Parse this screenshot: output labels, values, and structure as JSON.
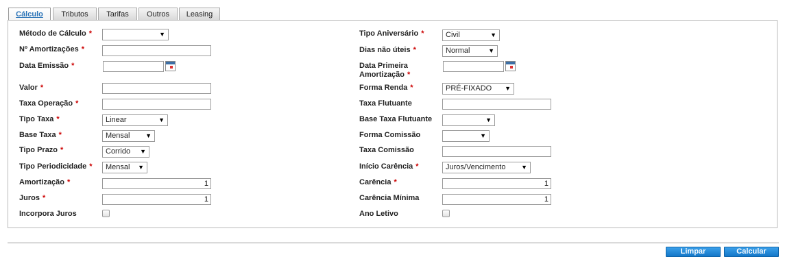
{
  "tabs": [
    "Cálculo",
    "Tributos",
    "Tarifas",
    "Outros",
    "Leasing"
  ],
  "required_mark": "*",
  "left": {
    "metodo_calculo": {
      "label": "Método de Cálculo",
      "value": ""
    },
    "num_amortizacoes": {
      "label": "Nº Amortizações",
      "value": ""
    },
    "data_emissao": {
      "label": "Data Emissão",
      "value": ""
    },
    "valor": {
      "label": "Valor",
      "value": ""
    },
    "taxa_operacao": {
      "label": "Taxa Operação",
      "value": ""
    },
    "tipo_taxa": {
      "label": "Tipo Taxa",
      "value": "Linear"
    },
    "base_taxa": {
      "label": "Base Taxa",
      "value": "Mensal"
    },
    "tipo_prazo": {
      "label": "Tipo Prazo",
      "value": "Corrido"
    },
    "tipo_periodicidade": {
      "label": "Tipo Periodicidade",
      "value": "Mensal"
    },
    "amortizacao": {
      "label": "Amortização",
      "value": "1"
    },
    "juros": {
      "label": "Juros",
      "value": "1"
    },
    "incorpora_juros": {
      "label": "Incorpora Juros",
      "checked": false
    }
  },
  "right": {
    "tipo_aniversario": {
      "label": "Tipo Aniversário",
      "value": "Civil"
    },
    "dias_nao_uteis": {
      "label": "Dias não úteis",
      "value": "Normal"
    },
    "data_primeira_amortizacao": {
      "label_line1": "Data Primeira",
      "label_line2": "Amortização",
      "value": ""
    },
    "forma_renda": {
      "label": "Forma Renda",
      "value": "PRÉ-FIXADO"
    },
    "taxa_flutuante": {
      "label": "Taxa Flutuante",
      "value": ""
    },
    "base_taxa_flutuante": {
      "label": "Base Taxa Flutuante",
      "value": ""
    },
    "forma_comissao": {
      "label": "Forma Comissão",
      "value": ""
    },
    "taxa_comissao": {
      "label": "Taxa Comissão",
      "value": ""
    },
    "inicio_carencia": {
      "label": "Início Carência",
      "value": "Juros/Vencimento"
    },
    "carencia": {
      "label": "Carência",
      "value": "1"
    },
    "carencia_minima": {
      "label": "Carência Mínima",
      "value": "1"
    },
    "ano_letivo": {
      "label": "Ano Letivo",
      "checked": false
    }
  },
  "buttons": {
    "limpar": "Limpar",
    "calcular": "Calcular"
  },
  "colors": {
    "button": "#1a82d2",
    "active_tab_text": "#2b74b8",
    "required": "#cc0000"
  }
}
